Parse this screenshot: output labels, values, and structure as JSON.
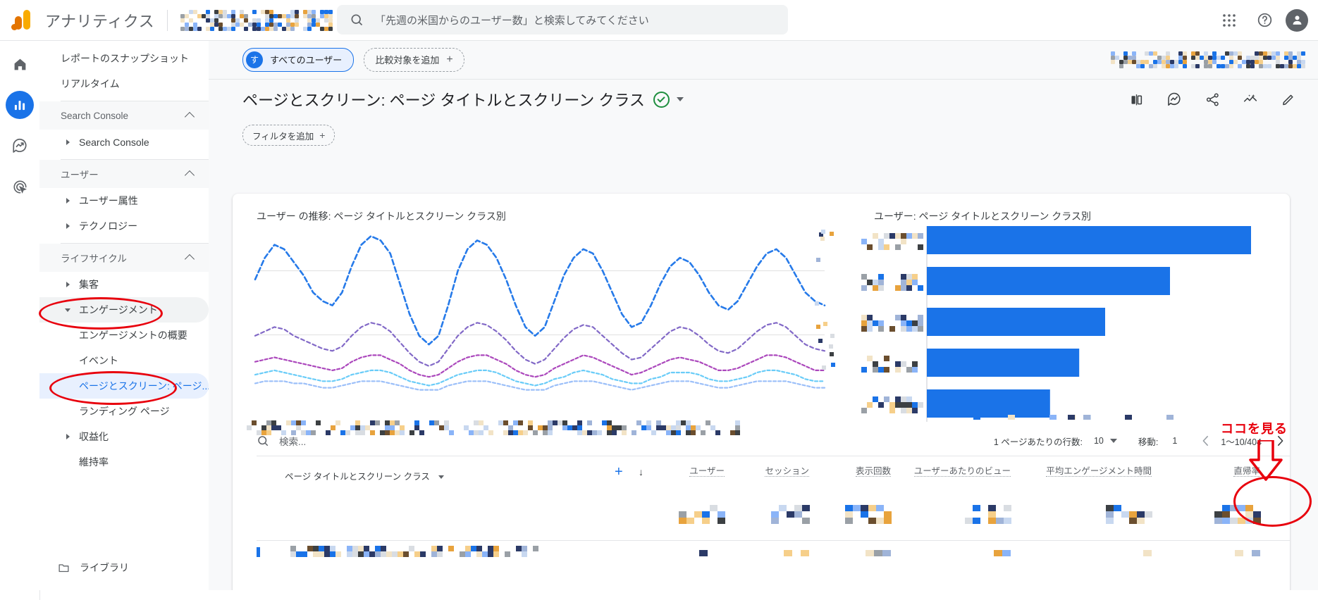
{
  "header": {
    "brand": "アナリティクス",
    "property_redacted": true,
    "search_placeholder": "「先週の米国からのユーザー数」と検索してみてください",
    "apps_icon": "apps-grid-icon",
    "help_icon": "help-circle-icon",
    "avatar_icon": "user-avatar"
  },
  "rail": {
    "items": [
      {
        "name": "home",
        "icon": "home-icon",
        "active": false
      },
      {
        "name": "reports",
        "icon": "bar-chart-icon",
        "active": true
      },
      {
        "name": "explore",
        "icon": "explore-icon",
        "active": false
      },
      {
        "name": "advertising",
        "icon": "advertising-icon",
        "active": false
      }
    ]
  },
  "sidebar": {
    "items": [
      {
        "label": "レポートのスナップショット",
        "type": "item",
        "indent": false,
        "selected": false
      },
      {
        "label": "リアルタイム",
        "type": "item",
        "indent": false,
        "selected": false
      },
      {
        "label": "Search Console",
        "type": "section",
        "expanded": true
      },
      {
        "label": "Search Console",
        "type": "item",
        "tri": true,
        "selected": false
      },
      {
        "label": "ユーザー",
        "type": "section",
        "expanded": true
      },
      {
        "label": "ユーザー属性",
        "type": "item",
        "tri": true,
        "selected": false
      },
      {
        "label": "テクノロジー",
        "type": "item",
        "tri": true,
        "selected": false
      },
      {
        "label": "ライフサイクル",
        "type": "section",
        "expanded": true
      },
      {
        "label": "集客",
        "type": "item",
        "tri": true,
        "selected": false
      },
      {
        "label": "エンゲージメント",
        "type": "item",
        "tri": "down",
        "selected": false,
        "annotated": true
      },
      {
        "label": "エンゲージメントの概要",
        "type": "item",
        "sub": true,
        "selected": false
      },
      {
        "label": "イベント",
        "type": "item",
        "sub": true,
        "selected": false
      },
      {
        "label": "ページとスクリーン: ページ...",
        "type": "item",
        "sub": true,
        "selected": true,
        "annotated": true
      },
      {
        "label": "ランディング ページ",
        "type": "item",
        "sub": true,
        "selected": false
      },
      {
        "label": "収益化",
        "type": "item",
        "tri": true,
        "selected": false
      },
      {
        "label": "維持率",
        "type": "item",
        "sub": false,
        "selected": false
      }
    ],
    "library": {
      "label": "ライブラリ",
      "icon": "library-icon"
    }
  },
  "toolbar": {
    "segment_chip": {
      "avatar": "す",
      "label": "すべてのユーザー"
    },
    "compare_chip": {
      "label": "比較対象を追加",
      "plus": "+"
    },
    "date_range_redacted": true
  },
  "page": {
    "title": "ページとスクリーン: ページ タイトルとスクリーン クラス",
    "verified_icon": "verified-check-icon",
    "title_caret": "chevron-down-icon",
    "filter_chip": {
      "label": "フィルタを追加",
      "plus": "+"
    },
    "actions": [
      {
        "name": "compare-icon"
      },
      {
        "name": "insights-icon"
      },
      {
        "name": "share-icon"
      },
      {
        "name": "analysis-icon"
      },
      {
        "name": "edit-pencil-icon"
      }
    ]
  },
  "charts": {
    "line": {
      "title": "ユーザー の推移: ページ タイトルとスクリーン クラス別"
    },
    "bar": {
      "title": "ユーザー: ページ タイトルとスクリーン クラス別"
    }
  },
  "chart_data": [
    {
      "type": "line",
      "title": "ユーザー の推移: ページ タイトルとスクリーン クラス別",
      "xlabel": "",
      "ylabel": "",
      "grid": true,
      "legend": "bottom",
      "labels_redacted": true,
      "x": [
        0,
        1,
        2,
        3,
        4,
        5,
        6,
        7,
        8,
        9,
        10,
        11,
        12,
        13,
        14,
        15,
        16,
        17,
        18,
        19,
        20,
        21,
        22,
        23,
        24,
        25,
        26,
        27,
        28,
        29,
        30,
        31,
        32,
        33,
        34,
        35,
        36,
        37,
        38,
        39,
        40,
        41,
        42,
        43,
        44,
        45,
        46,
        47,
        48,
        49,
        50,
        51,
        52,
        53,
        54,
        55,
        56,
        57,
        58,
        59
      ],
      "series": [
        {
          "name": "series-1",
          "color": "#1a73e8",
          "values": [
            56,
            66,
            72,
            70,
            64,
            58,
            50,
            46,
            44,
            50,
            62,
            72,
            76,
            74,
            68,
            54,
            40,
            30,
            26,
            30,
            44,
            60,
            70,
            74,
            72,
            66,
            56,
            44,
            34,
            30,
            34,
            46,
            58,
            66,
            70,
            68,
            60,
            50,
            40,
            34,
            36,
            44,
            54,
            62,
            66,
            64,
            58,
            50,
            44,
            42,
            46,
            54,
            62,
            68,
            70,
            66,
            58,
            50,
            46,
            44
          ]
        },
        {
          "name": "series-2",
          "color": "#7b61c4",
          "values": [
            30,
            32,
            34,
            33,
            30,
            28,
            26,
            24,
            23,
            25,
            30,
            34,
            36,
            35,
            32,
            27,
            22,
            18,
            16,
            18,
            24,
            30,
            34,
            36,
            35,
            32,
            28,
            23,
            19,
            17,
            19,
            24,
            29,
            33,
            35,
            34,
            30,
            26,
            22,
            19,
            20,
            24,
            28,
            32,
            34,
            33,
            30,
            26,
            23,
            22,
            24,
            28,
            32,
            35,
            36,
            34,
            30,
            26,
            24,
            23
          ]
        },
        {
          "name": "series-3",
          "color": "#9c27b0",
          "values": [
            18,
            19,
            20,
            19,
            18,
            17,
            16,
            15,
            14,
            15,
            18,
            20,
            21,
            21,
            19,
            17,
            14,
            12,
            11,
            12,
            15,
            18,
            20,
            21,
            21,
            19,
            17,
            14,
            12,
            11,
            12,
            15,
            17,
            19,
            21,
            20,
            18,
            16,
            14,
            12,
            13,
            15,
            17,
            19,
            20,
            19,
            18,
            16,
            14,
            14,
            15,
            17,
            19,
            21,
            21,
            20,
            18,
            16,
            14,
            14
          ]
        },
        {
          "name": "series-4",
          "color": "#4fc3f7",
          "values": [
            12,
            13,
            14,
            13,
            12,
            11,
            10,
            9,
            9,
            10,
            12,
            13,
            14,
            14,
            13,
            11,
            9,
            8,
            7,
            8,
            10,
            12,
            13,
            14,
            14,
            13,
            11,
            9,
            8,
            7,
            8,
            10,
            11,
            13,
            14,
            13,
            12,
            10,
            9,
            8,
            8,
            10,
            11,
            13,
            13,
            13,
            12,
            10,
            9,
            9,
            10,
            11,
            13,
            14,
            14,
            13,
            12,
            10,
            9,
            9
          ]
        },
        {
          "name": "series-5",
          "color": "#8ab4f8",
          "values": [
            8,
            9,
            9,
            9,
            8,
            8,
            7,
            6,
            6,
            7,
            8,
            9,
            9,
            9,
            8,
            7,
            6,
            5,
            5,
            5,
            7,
            8,
            9,
            9,
            9,
            8,
            7,
            6,
            5,
            5,
            5,
            7,
            8,
            9,
            9,
            9,
            8,
            7,
            6,
            5,
            6,
            7,
            8,
            9,
            9,
            9,
            8,
            7,
            6,
            6,
            7,
            8,
            9,
            9,
            9,
            9,
            8,
            7,
            6,
            6
          ]
        }
      ]
    },
    {
      "type": "bar",
      "title": "ユーザー: ページ タイトルとスクリーン クラス別",
      "orientation": "horizontal",
      "categories_redacted": true,
      "categories": [
        "row-1",
        "row-2",
        "row-3",
        "row-4",
        "row-5"
      ],
      "values": [
        100,
        75,
        55,
        47,
        38
      ],
      "color": "#1a73e8",
      "ylim": [
        0,
        100
      ]
    }
  ],
  "table": {
    "search_placeholder": "検索...",
    "rows_per_page_label": "1 ページあたりの行数:",
    "rows_per_page_value": "10",
    "goto_label": "移動:",
    "goto_value": "1",
    "range_label": "1〜10/404",
    "prev_icon": "chevron-left-icon",
    "next_icon": "chevron-right-icon",
    "dimension_header": "ページ タイトルとスクリーン クラス",
    "add_column": "+",
    "sort_arrow": "↓",
    "columns": [
      {
        "label": "ユーザー",
        "sorted": true
      },
      {
        "label": "セッション",
        "sorted": false
      },
      {
        "label": "表示回数",
        "sorted": false
      },
      {
        "label": "ユーザーあたりのビュー",
        "sorted": false
      },
      {
        "label": "平均エンゲージメント時間",
        "sorted": false
      },
      {
        "label": "直帰率",
        "sorted": false,
        "annotated": true
      }
    ],
    "values_redacted": true
  },
  "annotations": [
    {
      "kind": "ellipse",
      "target": "sidebar-engagement",
      "color": "#e8000d"
    },
    {
      "kind": "ellipse",
      "target": "sidebar-pages-and-screens",
      "color": "#e8000d"
    },
    {
      "kind": "ellipse",
      "target": "bounce-rate-column",
      "color": "#e8000d"
    },
    {
      "kind": "text",
      "text": "ココを見る",
      "color": "#e8000d"
    },
    {
      "kind": "arrow-down",
      "target": "bounce-rate-column",
      "color": "#e8000d"
    }
  ]
}
